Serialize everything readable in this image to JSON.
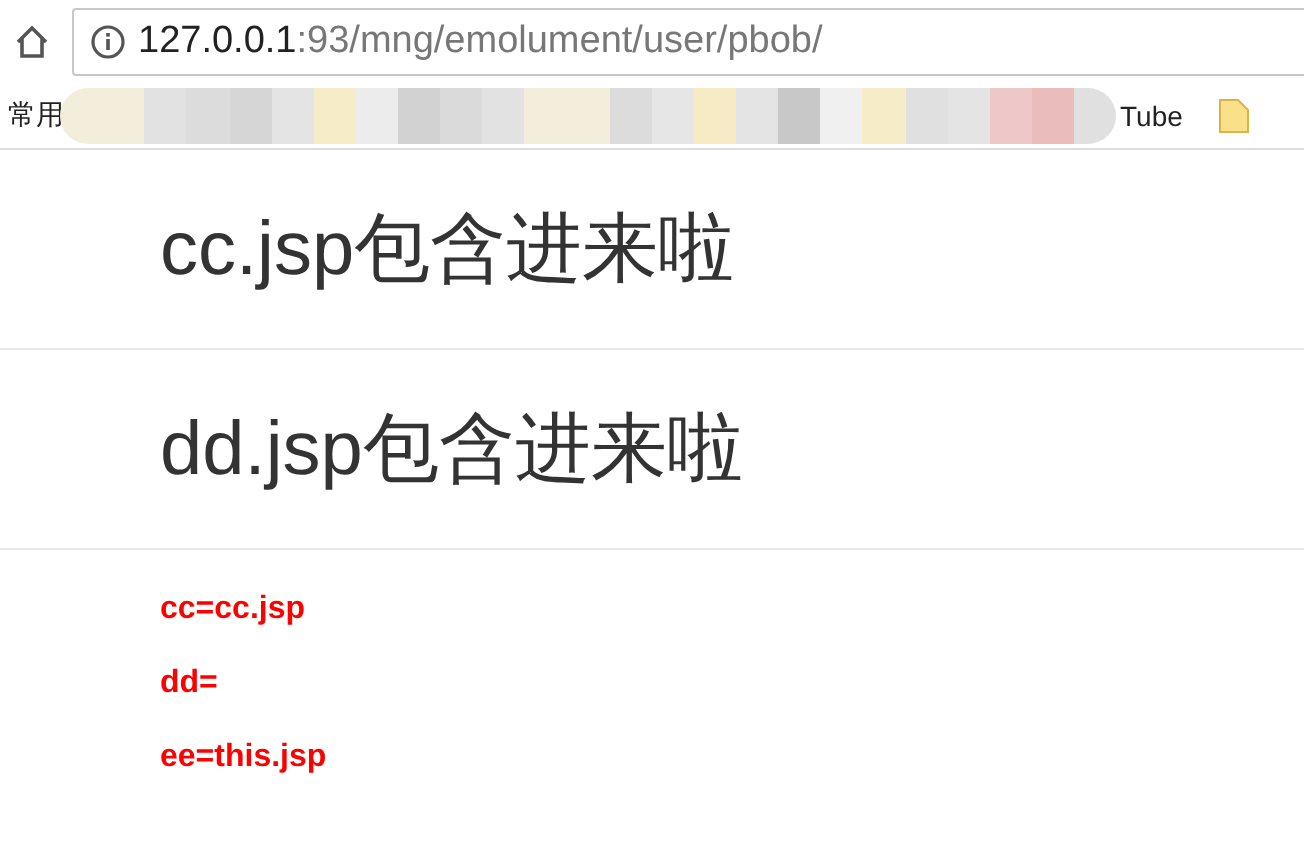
{
  "address_bar": {
    "host": "127.0.0.1",
    "path": ":93/mng/emolument/user/pbob/"
  },
  "bookmarks": {
    "left_label": "常用",
    "right_label": "Tube"
  },
  "includes": [
    "cc.jsp包含进来啦",
    "dd.jsp包含进来啦"
  ],
  "params": [
    "cc=cc.jsp",
    "dd=",
    "ee=this.jsp"
  ]
}
